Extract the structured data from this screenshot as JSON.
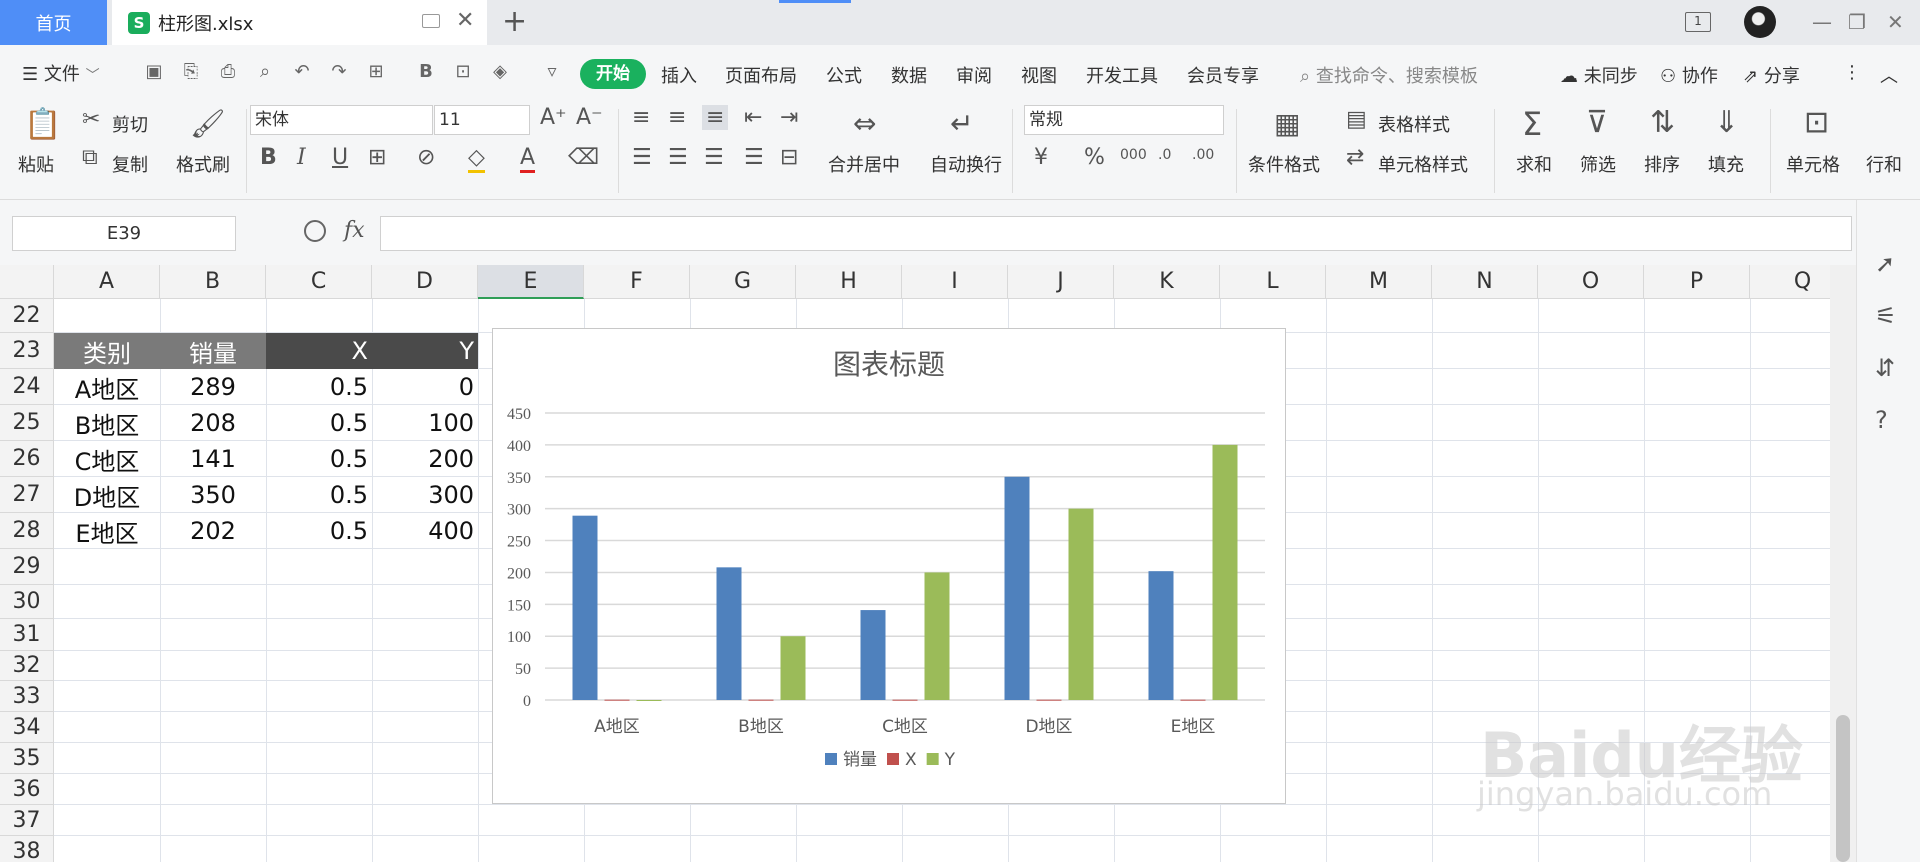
{
  "tabs": {
    "home": "首页",
    "file_icon_letter": "S",
    "file_name": "柱形图.xlsx",
    "page_badge": "1"
  },
  "menu": {
    "file": "文件",
    "start": "开始",
    "items": [
      "插入",
      "页面布局",
      "公式",
      "数据",
      "审阅",
      "视图",
      "开发工具",
      "会员专享"
    ],
    "search_placeholder": "查找命令、搜索模板",
    "sync": "未同步",
    "collaborate": "协作",
    "share": "分享"
  },
  "ribbon": {
    "paste": "粘贴",
    "cut": "剪切",
    "copy": "复制",
    "format_painter": "格式刷",
    "font_name": "宋体",
    "font_size": "11",
    "merge_center": "合并居中",
    "wrap_text": "自动换行",
    "number_format": "常规",
    "conditional_format": "条件格式",
    "table_style": "表格样式",
    "cell_style": "单元格样式",
    "sum": "求和",
    "filter": "筛选",
    "sort": "排序",
    "fill": "填充",
    "cell": "单元格",
    "rowcol": "行和",
    "percent": "%",
    "thousands": "000",
    "dec_inc": ".0",
    "dec_dec": ".00"
  },
  "formula_bar": {
    "name_box": "E39",
    "fx": "fx",
    "formula": ""
  },
  "sheet": {
    "columns": [
      "A",
      "B",
      "C",
      "D",
      "E",
      "F",
      "G",
      "H",
      "I",
      "J",
      "K",
      "L",
      "M",
      "N",
      "O",
      "P",
      "Q"
    ],
    "rows": [
      "22",
      "23",
      "24",
      "25",
      "26",
      "27",
      "28",
      "29",
      "30",
      "31",
      "32",
      "33",
      "34",
      "35",
      "36",
      "37",
      "38"
    ],
    "table_header": [
      "类别",
      "销量",
      "X",
      "Y"
    ],
    "table_rows": [
      [
        "A地区",
        "289",
        "0.5",
        "0"
      ],
      [
        "B地区",
        "208",
        "0.5",
        "100"
      ],
      [
        "C地区",
        "141",
        "0.5",
        "200"
      ],
      [
        "D地区",
        "350",
        "0.5",
        "300"
      ],
      [
        "E地区",
        "202",
        "0.5",
        "400"
      ]
    ]
  },
  "chart_data": {
    "type": "bar",
    "title": "图表标题",
    "categories": [
      "A地区",
      "B地区",
      "C地区",
      "D地区",
      "E地区"
    ],
    "series": [
      {
        "name": "销量",
        "values": [
          289,
          208,
          141,
          350,
          202
        ],
        "color": "#4f81bd"
      },
      {
        "name": "X",
        "values": [
          0.5,
          0.5,
          0.5,
          0.5,
          0.5
        ],
        "color": "#c0504d"
      },
      {
        "name": "Y",
        "values": [
          0,
          100,
          200,
          300,
          400
        ],
        "color": "#9bbb59"
      }
    ],
    "ylim": [
      0,
      450
    ],
    "yticks": [
      "0",
      "50",
      "100",
      "150",
      "200",
      "250",
      "300",
      "350",
      "400",
      "450"
    ],
    "grid": true,
    "legend": "bottom"
  },
  "watermark": {
    "brand": "Baidu经验",
    "url": "jingyan.baidu.com"
  }
}
